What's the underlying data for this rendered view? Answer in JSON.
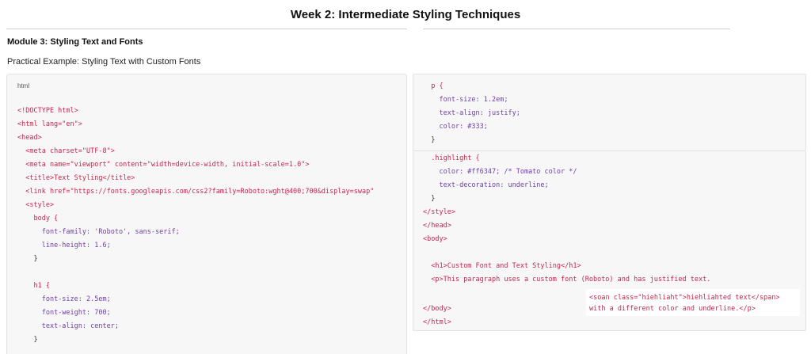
{
  "page": {
    "title": "Week 2: Intermediate Styling Techniques",
    "module_heading": "Module 3: Styling Text and Fonts",
    "sub_heading": "Practical Example: Styling Text with Custom Fonts",
    "code_language": "html"
  },
  "code": {
    "doctype": "<!DOCTYPE html>",
    "html_open": "<html lang=\"en\">",
    "head_open": "<head>",
    "meta_charset": "<meta charset=\"UTF-8\">",
    "meta_viewport": "<meta name=\"viewport\" content=\"width=device-width, initial-scale=1.0\">",
    "title_tag": "<title>Text Styling</title>",
    "link_tag": "<link href=\"https://fonts.googleapis.com/css2?family=Roboto:wght@400;700&display=swap\"",
    "style_open": "<style>",
    "body_selector": "body {",
    "body_font_family": "font-family: 'Roboto', sans-serif;",
    "body_line_height": "line-height: 1.6;",
    "close_brace": "}",
    "h1_selector": "h1 {",
    "h1_font_size": "font-size: 2.5em;",
    "h1_font_weight": "font-weight: 700;",
    "h1_text_align": "text-align: center;",
    "p_selector": "p {",
    "p_font_size": "font-size: 1.2em;",
    "p_text_align": "text-align: justify;",
    "p_color": "color: #333;",
    "highlight_selector": ".highlight {",
    "highlight_color": "color: #ff6347; /* Tomato color */",
    "highlight_decoration": "text-decoration: underline;",
    "style_close": "</style>",
    "head_close": "</head>",
    "body_open": "<body>",
    "h1_element": "<h1>Custom Font and Text Styling</h1>",
    "p_element": "<p>This paragraph uses a custom font (Roboto) and has justified text.",
    "span_element": "<soan class=\"hiehliaht\">hiehliahted text</span>",
    "p_continued": "with a different color and underline.</p>",
    "body_close": "</body>",
    "html_close": "</html>"
  }
}
